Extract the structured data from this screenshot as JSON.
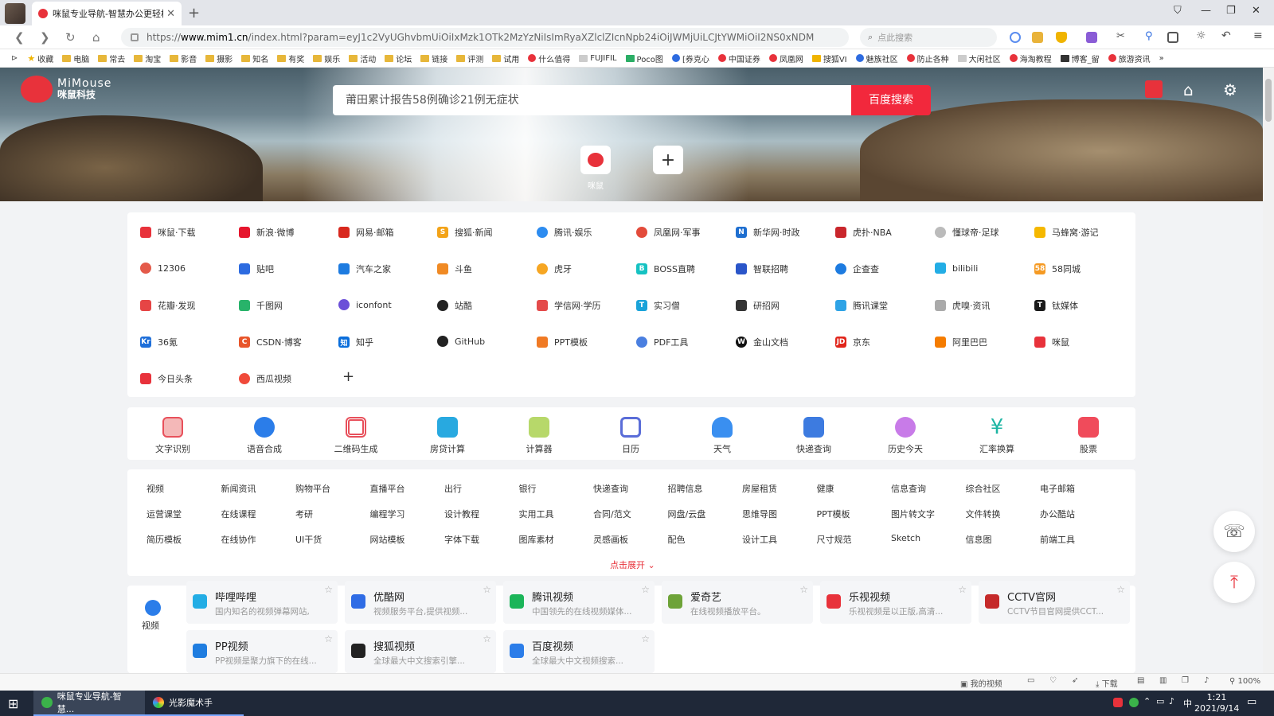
{
  "browser": {
    "tab_title": "咪鼠专业导航-智慧办公更轻松",
    "new_tab": "+",
    "url_prefix": "https://",
    "url_host": "www.mim1.cn",
    "url_rest": "/index.html?param=eyJ1c2VyUGhvbmUiOiIxMzk1OTk2MzYzNiIsImRyaXZlclZIcnNpb24iOiJWMjUiLCJtYWMiOiI2NS0xNDM",
    "search_placeholder": "点此搜索",
    "bookmarks": [
      "收藏",
      "电脑",
      "常去",
      "淘宝",
      "影音",
      "摄影",
      "知名",
      "有奖",
      "娱乐",
      "活动",
      "论坛",
      "链接",
      "评测",
      "试用",
      "什么值得",
      "FUJIFIL",
      "Poco图",
      "[券克心",
      "中国证券",
      "凤凰网",
      "搜狐VI",
      "魅族社区",
      "防止各种",
      "大闲社区",
      "海淘教程",
      "博客_留",
      "旅游资讯"
    ],
    "more_bookmarks": "»"
  },
  "hero": {
    "logo_en": "MiMouse",
    "logo_cn": "咪鼠科技",
    "search_text": "莆田累计报告58例确诊21例无症状",
    "search_button": "百度搜索",
    "tile_label": "咪鼠",
    "add_label": "+"
  },
  "sites": [
    [
      "咪鼠·下载",
      "新浪·微博",
      "网易·邮箱",
      "搜狐·新闻",
      "腾讯·娱乐",
      "凤凰网·军事",
      "新华网·时政",
      "虎扑·NBA",
      "懂球帝·足球",
      "马蜂窝·游记"
    ],
    [
      "12306",
      "贴吧",
      "汽车之家",
      "斗鱼",
      "虎牙",
      "BOSS直聘",
      "智联招聘",
      "企查查",
      "bilibili",
      "58同城"
    ],
    [
      "花瓣·发现",
      "千图网",
      "iconfont",
      "站酷",
      "学信网·学历",
      "实习僧",
      "研招网",
      "腾讯课堂",
      "虎嗅·资讯",
      "钛媒体"
    ],
    [
      "36氪",
      "CSDN·博客",
      "知乎",
      "GitHub",
      "PPT模板",
      "PDF工具",
      "金山文档",
      "京东",
      "阿里巴巴",
      "咪鼠"
    ],
    [
      "今日头条",
      "西瓜视频"
    ]
  ],
  "sites_add": "+",
  "tools": [
    "文字识别",
    "语音合成",
    "二维码生成",
    "房贷计算",
    "计算器",
    "日历",
    "天气",
    "快递查询",
    "历史今天",
    "汇率换算",
    "股票"
  ],
  "categories": [
    [
      "视频",
      "新闻资讯",
      "购物平台",
      "直播平台",
      "出行",
      "银行",
      "快递查询",
      "招聘信息",
      "房屋租赁",
      "健康",
      "信息查询",
      "综合社区",
      "电子邮箱"
    ],
    [
      "运营课堂",
      "在线课程",
      "考研",
      "编程学习",
      "设计教程",
      "实用工具",
      "合同/范文",
      "网盘/云盘",
      "思维导图",
      "PPT模板",
      "图片转文字",
      "文件转换",
      "办公酷站"
    ],
    [
      "简历模板",
      "在线协作",
      "UI干货",
      "网站模板",
      "字体下载",
      "图库素材",
      "灵感画板",
      "配色",
      "设计工具",
      "尺寸规范",
      "Sketch",
      "信息图",
      "前端工具"
    ]
  ],
  "expand": "点击展开",
  "video_section": {
    "label": "视频",
    "cards": [
      {
        "name": "哔哩哔哩",
        "desc": "国内知名的视频弹幕网站,"
      },
      {
        "name": "优酷网",
        "desc": "视频服务平台,提供视频..."
      },
      {
        "name": "腾讯视频",
        "desc": "中国领先的在线视频媒体..."
      },
      {
        "name": "爱奇艺",
        "desc": "在线视频播放平台。"
      },
      {
        "name": "乐视视频",
        "desc": "乐视视频是以正版,高清..."
      },
      {
        "name": "CCTV官网",
        "desc": "CCTV节目官网提供CCT..."
      },
      {
        "name": "PP视频",
        "desc": "PP视频是聚力旗下的在线..."
      },
      {
        "name": "搜狐视频",
        "desc": "全球最大中文搜索引擎..."
      },
      {
        "name": "百度视频",
        "desc": "全球最大中文视频搜索..."
      }
    ]
  },
  "statusbar": {
    "video": "我的视频",
    "download": "下载",
    "zoom": "100%"
  },
  "taskbar": {
    "app1": "咪鼠专业导航-智慧...",
    "app2": "光影魔术手",
    "time": "1:21",
    "date": "2021/9/14",
    "ime": "中"
  },
  "colors": {
    "accent": "#f2283c",
    "brand": "#e8323b"
  }
}
